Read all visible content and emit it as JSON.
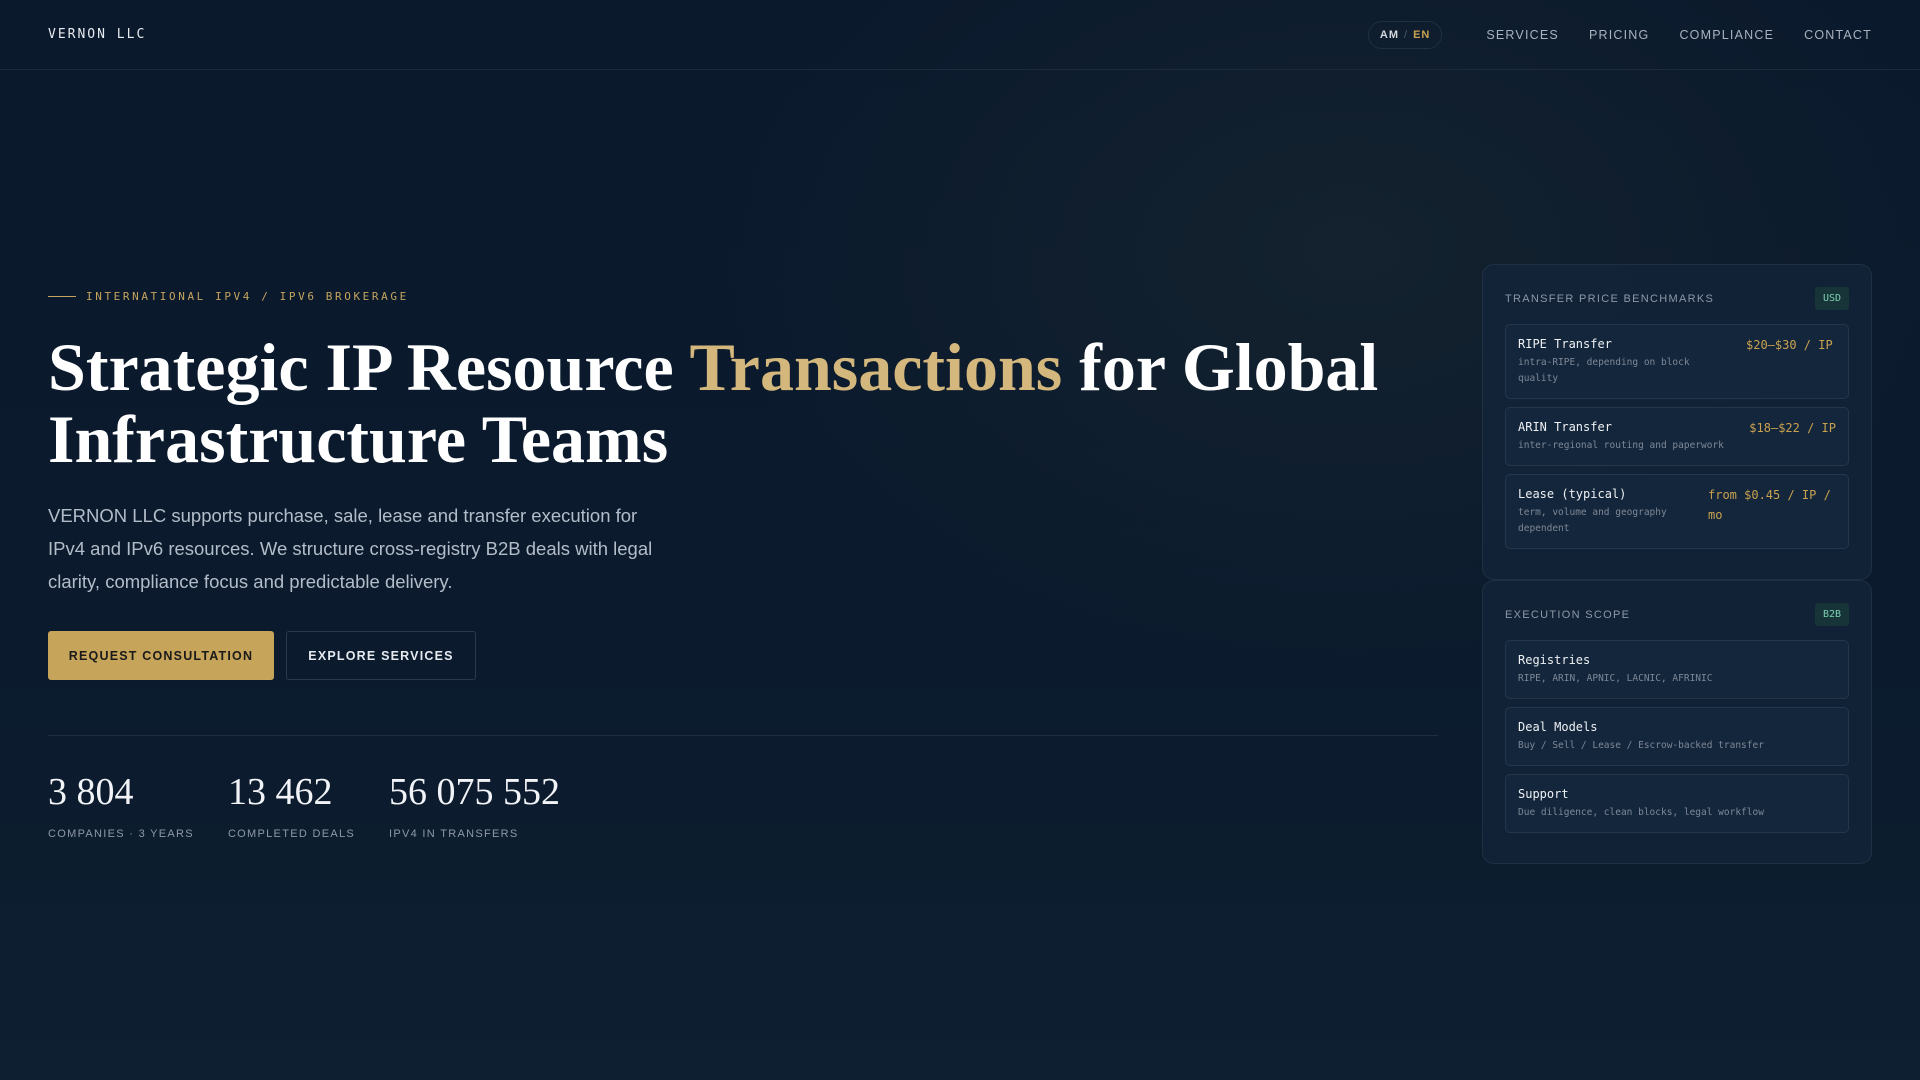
{
  "nav": {
    "logo": "VERNON LLC",
    "lang_am": "AM",
    "lang_sep": "/",
    "lang_en": "EN",
    "links": [
      "SERVICES",
      "PRICING",
      "COMPLIANCE",
      "CONTACT"
    ]
  },
  "hero": {
    "eyebrow": "INTERNATIONAL IPV4 / IPV6 BROKERAGE",
    "title_part1": "Strategic IP Resource ",
    "title_highlight": "Transactions",
    "title_part2": " for Global Infrastructure Teams",
    "lead": "VERNON LLC supports purchase, sale, lease and transfer execution for IPv4 and IPv6 resources. We structure cross-registry B2B deals with legal clarity, compliance focus and predictable delivery.",
    "primary_button": "REQUEST CONSULTATION",
    "secondary_button": "EXPLORE SERVICES"
  },
  "stats": [
    {
      "value": "3 804",
      "label": "COMPANIES · 3 YEARS"
    },
    {
      "value": "13 462",
      "label": "COMPLETED DEALS"
    },
    {
      "value": "56 075 552",
      "label": "IPV4 IN TRANSFERS"
    }
  ],
  "pricing": {
    "title": "TRANSFER PRICE BENCHMARKS",
    "badge": "USD",
    "items": [
      {
        "title": "RIPE Transfer",
        "sub": "intra-RIPE, depending on block quality",
        "price": "$20–$30 / IP"
      },
      {
        "title": "ARIN Transfer",
        "sub": "inter-regional routing and paperwork",
        "price": "$18–$22 / IP"
      },
      {
        "title": "Lease (typical)",
        "sub": "term, volume and geography dependent",
        "price": "from $0.45 / IP / mo"
      }
    ]
  },
  "scope": {
    "title": "EXECUTION SCOPE",
    "badge": "B2B",
    "items": [
      {
        "title": "Registries",
        "sub": "RIPE, ARIN, APNIC, LACNIC, AFRINIC"
      },
      {
        "title": "Deal Models",
        "sub": "Buy / Sell / Lease / Escrow-backed transfer"
      },
      {
        "title": "Support",
        "sub": "Due diligence, clean blocks, legal workflow"
      }
    ]
  }
}
